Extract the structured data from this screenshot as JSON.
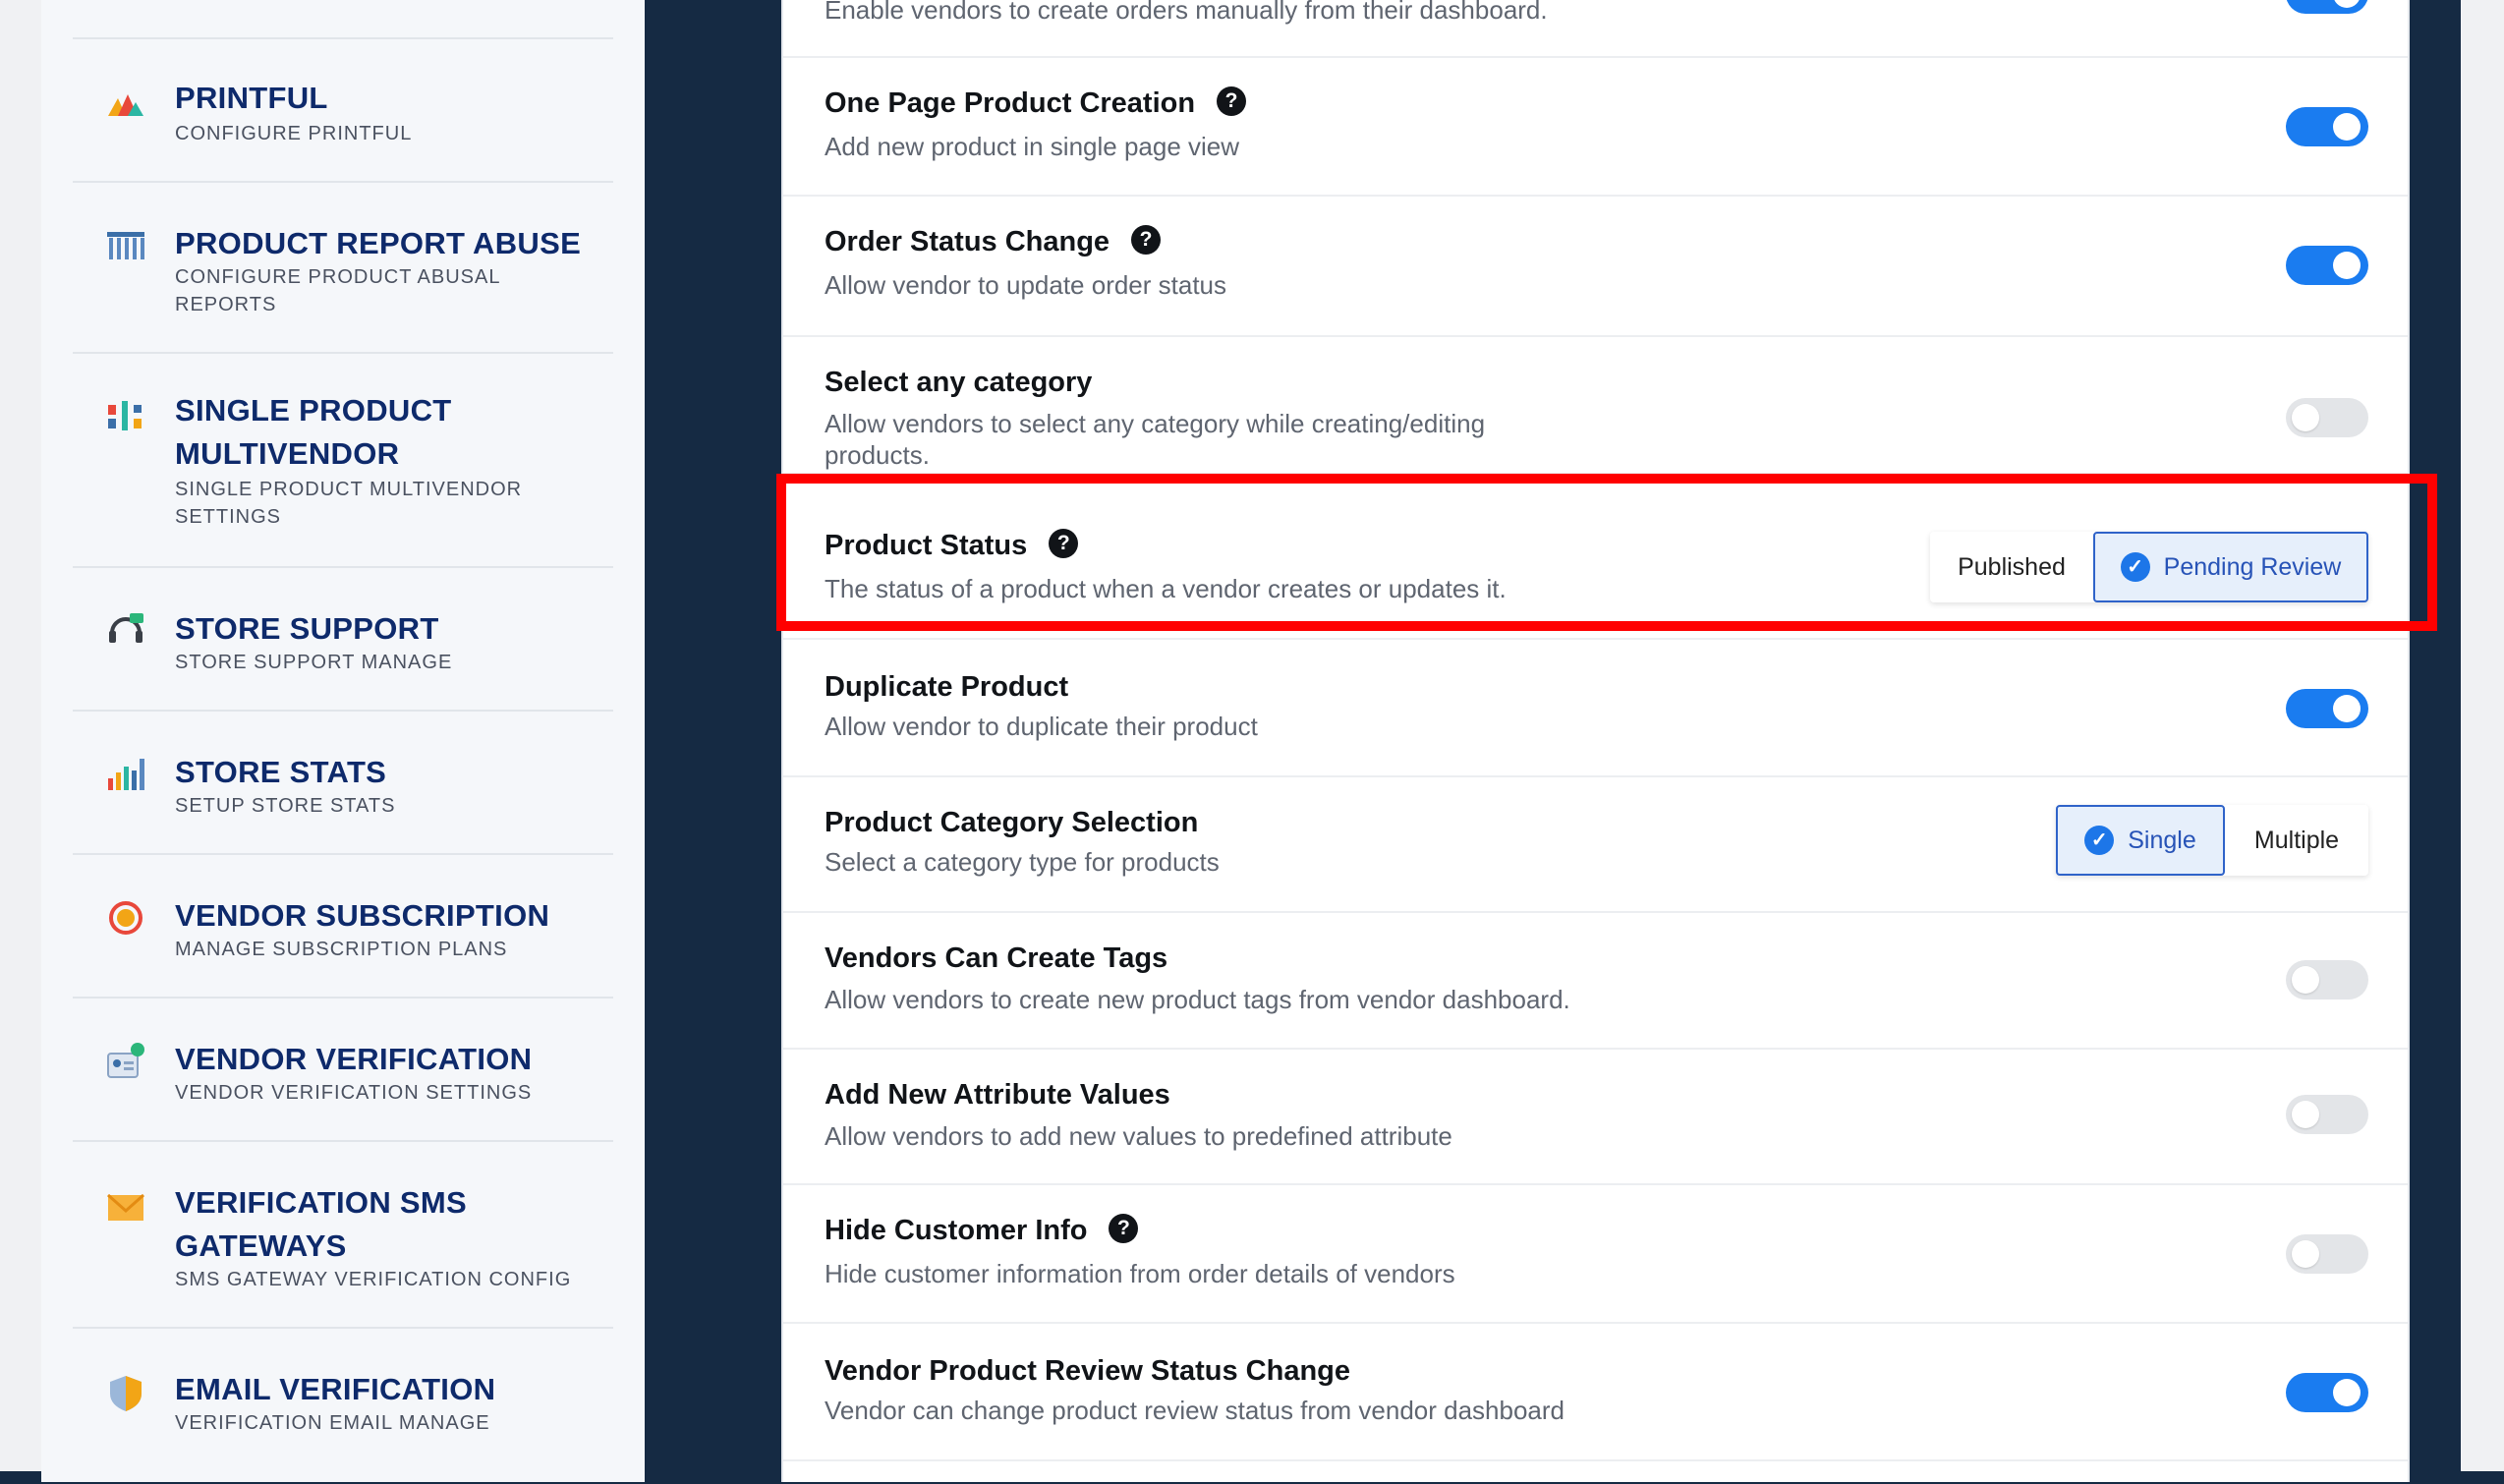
{
  "sidebar": {
    "items": [
      {
        "title": "PRINTFUL",
        "sub": "CONFIGURE PRINTFUL",
        "icon": "printful-logo-icon"
      },
      {
        "title": "PRODUCT REPORT ABUSE",
        "sub_lines": [
          "CONFIGURE PRODUCT ABUSAL",
          "REPORTS"
        ],
        "icon": "report-abuse-icon"
      },
      {
        "title_lines": [
          "SINGLE PRODUCT",
          "MULTIVENDOR"
        ],
        "sub_lines": [
          "SINGLE PRODUCT MULTIVENDOR",
          "SETTINGS"
        ],
        "icon": "multivendor-icon"
      },
      {
        "title": "STORE SUPPORT",
        "sub": "STORE SUPPORT MANAGE",
        "icon": "headset-icon"
      },
      {
        "title": "STORE STATS",
        "sub": "SETUP STORE STATS",
        "icon": "bar-chart-icon"
      },
      {
        "title": "VENDOR SUBSCRIPTION",
        "sub": "MANAGE SUBSCRIPTION PLANS",
        "icon": "subscription-icon"
      },
      {
        "title": "VENDOR VERIFICATION",
        "sub": "VENDOR VERIFICATION SETTINGS",
        "icon": "id-card-check-icon"
      },
      {
        "title_lines": [
          "VERIFICATION SMS",
          "GATEWAYS"
        ],
        "sub": "SMS GATEWAY VERIFICATION CONFIG",
        "icon": "envelope-icon"
      },
      {
        "title": "EMAIL VERIFICATION",
        "sub": "VERIFICATION EMAIL MANAGE",
        "icon": "shield-icon"
      }
    ]
  },
  "settings": {
    "top_partial_desc": "Enable vendors to create orders manually from their dashboard.",
    "rows": [
      {
        "title": "One Page Product Creation",
        "desc": "Add new product in single page view",
        "help": true,
        "toggle": "on"
      },
      {
        "title": "Order Status Change",
        "desc": "Allow vendor to update order status",
        "help": true,
        "toggle": "on"
      },
      {
        "title": "Select any category",
        "desc": "Allow vendors to select any category while creating/editing products.",
        "help": false,
        "toggle": "off"
      },
      {
        "title": "Product Status",
        "desc": "The status of a product when a vendor creates or updates it.",
        "help": true,
        "options": [
          "Published",
          "Pending Review"
        ],
        "selected": "Pending Review"
      },
      {
        "title": "Duplicate Product",
        "desc": "Allow vendor to duplicate their product",
        "help": false,
        "toggle": "on"
      },
      {
        "title": "Product Category Selection",
        "desc": "Select a category type for products",
        "help": false,
        "options": [
          "Single",
          "Multiple"
        ],
        "selected": "Single"
      },
      {
        "title": "Vendors Can Create Tags",
        "desc": "Allow vendors to create new product tags from vendor dashboard.",
        "help": false,
        "toggle": "off"
      },
      {
        "title": "Add New Attribute Values",
        "desc": "Allow vendors to add new values to predefined attribute",
        "help": false,
        "toggle": "off"
      },
      {
        "title": "Hide Customer Info",
        "desc": "Hide customer information from order details of vendors",
        "help": true,
        "toggle": "off"
      },
      {
        "title": "Vendor Product Review Status Change",
        "desc": "Vendor can change product review status from vendor dashboard",
        "help": false,
        "toggle": "on"
      }
    ]
  },
  "help_glyph": "?",
  "check_glyph": "✓",
  "colors": {
    "accent": "#1a7cf0",
    "sidebar_title": "#0e2a6b",
    "highlight": "#ff0000"
  }
}
